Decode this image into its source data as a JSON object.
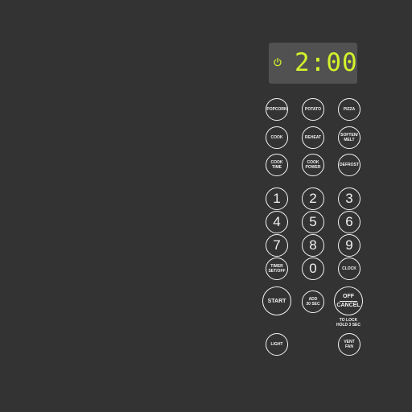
{
  "display": {
    "time": "2:00",
    "power_icon": "power-icon",
    "digit_color": "#d4f22a"
  },
  "buttons": {
    "popcorn": "POPCORN",
    "potato": "POTATO",
    "pizza": "PIZZA",
    "cook": "COOK",
    "reheat": "REHEAT",
    "soften_melt": "SOFTEN/\nMELT",
    "cook_time": "COOK\nTIME",
    "cook_power": "COOK\nPOWER",
    "defrost": "DEFROST",
    "num1": "1",
    "num2": "2",
    "num3": "3",
    "num4": "4",
    "num5": "5",
    "num6": "6",
    "num7": "7",
    "num8": "8",
    "num9": "9",
    "num0": "0",
    "timer": "TIMER\nSET/OFF",
    "clock": "CLOCK",
    "start": "START",
    "add30": "ADD\n30 SEC",
    "off_top": "OFF",
    "off_bottom": "CANCEL",
    "lock_note": "TO LOCK\nHOLD 3 SEC",
    "light": "LIGHT",
    "vent_fan": "VENT\nFAN"
  },
  "colors": {
    "panel": "#333333",
    "display_bg": "#515151",
    "button_line": "#f2f2f2"
  }
}
